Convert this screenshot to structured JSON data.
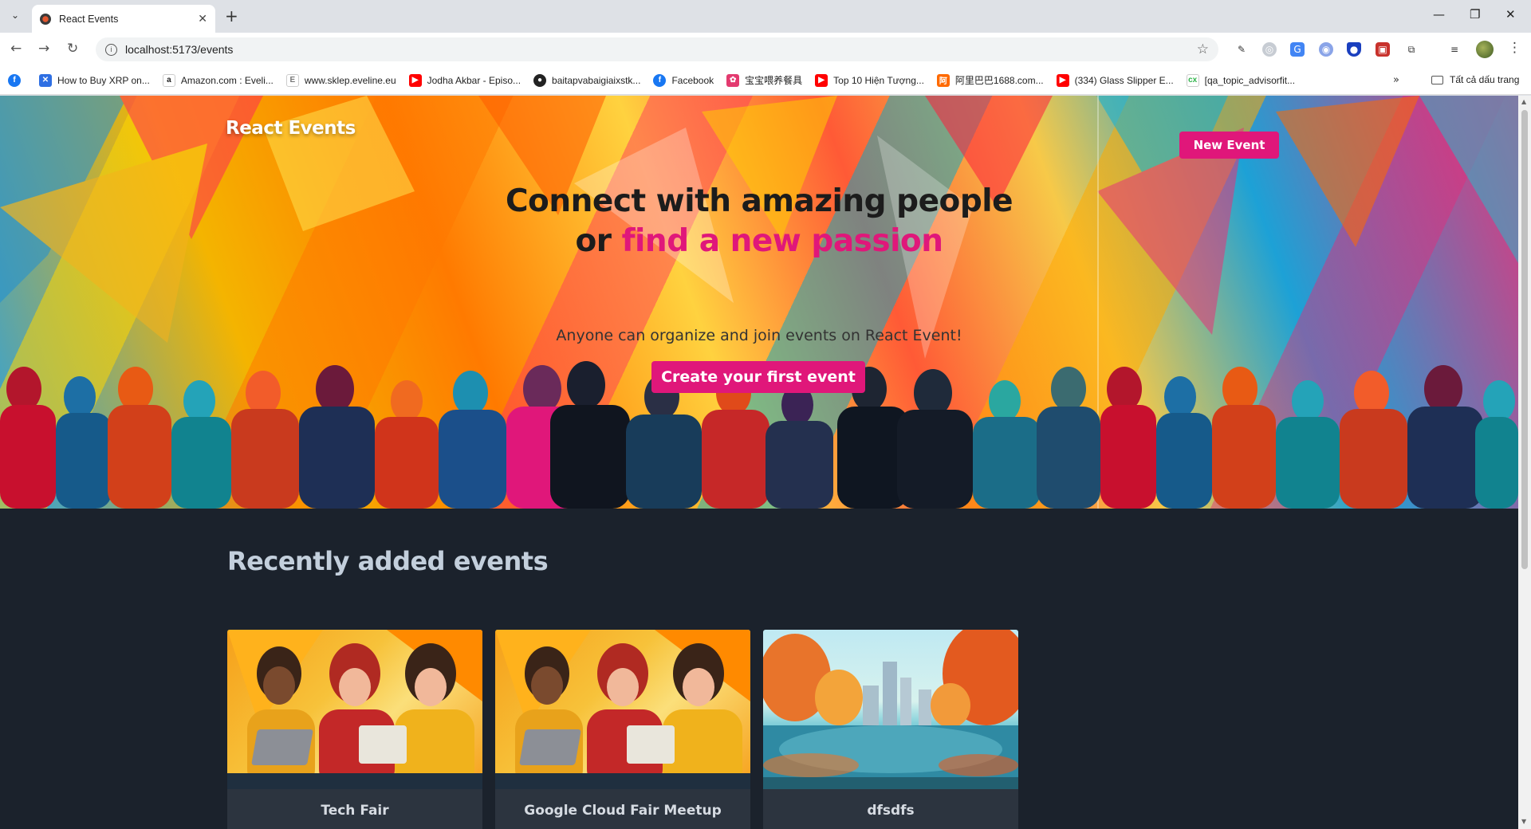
{
  "browser": {
    "tab_title": "React Events",
    "url": "localhost:5173/events",
    "bookmarks": [
      {
        "label": "",
        "icon": "facebook-icon",
        "color": "#1877f2"
      },
      {
        "label": "How to Buy XRP on...",
        "icon": "xrp-icon",
        "color": "#2e6fe3"
      },
      {
        "label": "Amazon.com : Eveli...",
        "icon": "amazon-icon",
        "color": "#222222"
      },
      {
        "label": "www.sklep.eveline.eu",
        "icon": "eveline-icon",
        "color": "#999999"
      },
      {
        "label": "Jodha Akbar - Episo...",
        "icon": "youtube-icon",
        "color": "#ff0000"
      },
      {
        "label": "baitapvabaigiaixstk...",
        "icon": "github-icon",
        "color": "#222222"
      },
      {
        "label": "Facebook",
        "icon": "facebook-icon",
        "color": "#1877f2"
      },
      {
        "label": "宝宝喂养餐具",
        "icon": "shop-icon",
        "color": "#e33a6f"
      },
      {
        "label": "Top 10 Hiện Tượng...",
        "icon": "youtube-icon",
        "color": "#ff0000"
      },
      {
        "label": "阿里巴巴1688.com...",
        "icon": "alibaba-icon",
        "color": "#ff6a00"
      },
      {
        "label": "(334) Glass Slipper E...",
        "icon": "youtube-icon",
        "color": "#ff0000"
      },
      {
        "label": "[qa_topic_advisorfit...",
        "icon": "cx-icon",
        "color": "#2fb34a"
      }
    ],
    "all_bookmarks_label": "Tất cả dấu trang"
  },
  "app": {
    "brand": "React Events",
    "new_event_label": "New Event",
    "hero": {
      "title_line1": "Connect with amazing people",
      "title_or": "or ",
      "title_accent": "find a new passion",
      "subtitle": "Anyone can organize and join events on React Event!",
      "cta_label": "Create your first event"
    },
    "section_title": "Recently added events",
    "events": [
      {
        "title": "Tech Fair"
      },
      {
        "title": "Google Cloud Fair Meetup"
      },
      {
        "title": "dfsdfs"
      }
    ],
    "accent_color": "#e0177a"
  }
}
